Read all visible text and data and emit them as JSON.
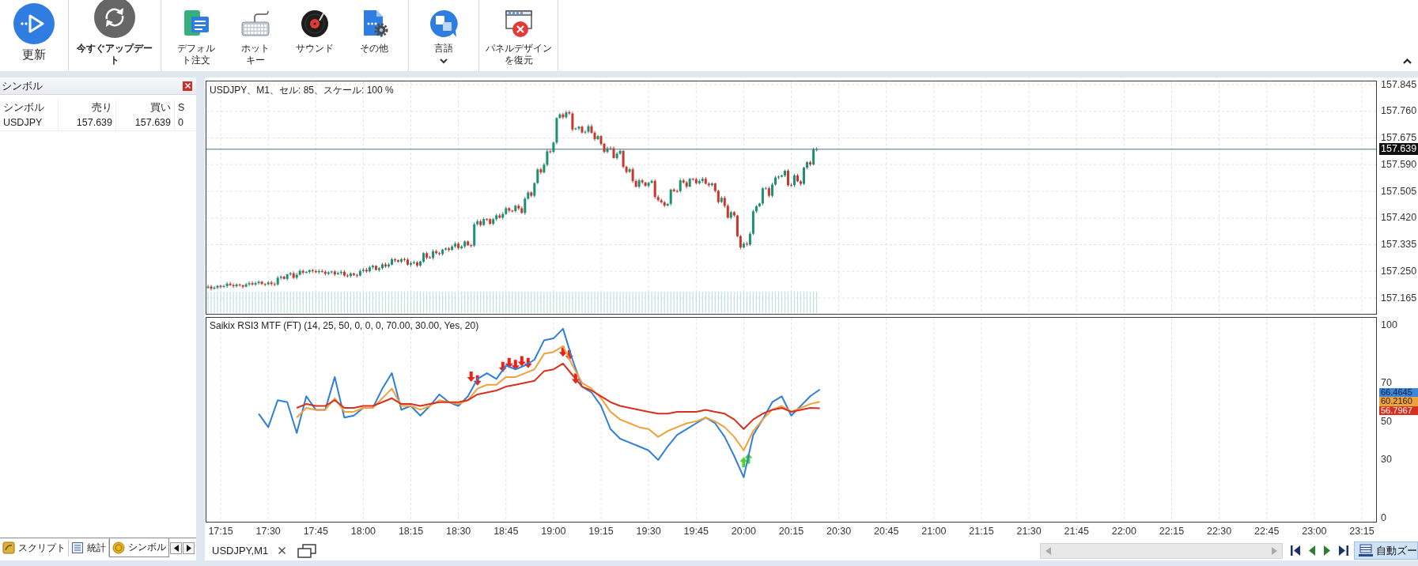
{
  "toolbar": {
    "groups": [
      {
        "buttons": [
          {
            "kind": "refresh",
            "label": "更新",
            "emphasized": false
          }
        ]
      },
      {
        "buttons": [
          {
            "kind": "update",
            "label": "今すぐアップデート",
            "emphasized": true
          }
        ]
      },
      {
        "buttons": [
          {
            "kind": "default_order",
            "label": "デフォルト注文",
            "emphasized": false
          },
          {
            "kind": "hotkey",
            "label": "ホットキー",
            "emphasized": false
          },
          {
            "kind": "sound",
            "label": "サウンド",
            "emphasized": false
          },
          {
            "kind": "other",
            "label": "その他",
            "emphasized": false
          }
        ]
      },
      {
        "buttons": [
          {
            "kind": "language",
            "label": "言語",
            "emphasized": false
          }
        ]
      },
      {
        "buttons": [
          {
            "kind": "restore_panels",
            "label": "パネルデザインを復元",
            "emphasized": false
          }
        ]
      }
    ]
  },
  "symbol_panel": {
    "title": "シンボル",
    "columns": [
      "シンボル",
      "売り",
      "買い",
      "S"
    ],
    "rows": [
      [
        "USDJPY",
        "157.639",
        "157.639",
        "0"
      ]
    ],
    "tabs": [
      {
        "kind": "scripts",
        "label": "スクリプト",
        "selected": false
      },
      {
        "kind": "stats",
        "label": "統計",
        "selected": false
      },
      {
        "kind": "symbols",
        "label": "シンボル",
        "selected": true
      }
    ]
  },
  "chart": {
    "title": "USDJPY、M1、セル: 85、スケール: 100 %",
    "price_axis": [
      "157.845",
      "157.760",
      "157.675",
      "157.590",
      "157.505",
      "157.420",
      "157.335",
      "157.250",
      "157.165"
    ],
    "current_price": "157.639",
    "indicator": {
      "chart_data": {
        "type": "line",
        "title": "Saikix RSI3 MTF (FT) (14, 25, 50, 0, 0, 0, 70.00, 30.00, Yes, 20)",
        "grid": true,
        "categories": [
          null,
          "17:15",
          null,
          null,
          null,
          null,
          "17:30",
          null,
          null,
          null,
          null,
          "17:45",
          null,
          null,
          null,
          null,
          "18:00",
          null,
          null,
          null,
          null,
          "18:15",
          null,
          null,
          null,
          null,
          "18:30",
          null,
          null,
          null,
          null,
          "18:45",
          null,
          null,
          null,
          null,
          "19:00",
          null,
          null,
          null,
          null,
          "19:15",
          null,
          null,
          null,
          null,
          "19:30",
          null,
          null,
          null,
          null,
          "19:45",
          null,
          null,
          null,
          null,
          "20:00",
          null,
          null,
          null,
          null,
          "20:15",
          null,
          null,
          null,
          null,
          "20:30",
          null,
          null,
          null,
          null,
          "20:45",
          null,
          null,
          null,
          null,
          "21:00",
          null,
          null,
          null,
          null,
          "21:15",
          null,
          null,
          null,
          null,
          "21:30",
          null,
          null,
          null,
          null,
          "21:45",
          null,
          null,
          null,
          null,
          "22:00",
          null,
          null,
          null,
          null,
          "22:15",
          null,
          null,
          null,
          null,
          "22:30",
          null,
          null,
          null,
          null,
          "22:45",
          null,
          null,
          null,
          null,
          "23:00",
          null,
          null,
          null,
          null,
          "23:15",
          null
        ],
        "ylim": [
          -2,
          103.7
        ],
        "yticks": [
          0,
          30,
          50,
          70,
          100
        ],
        "series": [
          {
            "color": "#2f7fd8",
            "values": [
              null,
              null,
              null,
              null,
              null,
              54,
              47,
              61,
              60,
              44,
              63,
              56,
              56,
              73,
              52,
              53,
              57,
              57,
              67,
              75,
              56,
              58,
              53,
              58,
              64,
              60,
              58,
              63,
              72,
              75,
              72,
              79,
              77,
              79,
              82,
              92,
              93,
              98,
              82,
              68,
              65,
              58,
              46,
              41,
              39,
              37,
              35,
              30,
              37,
              43,
              46,
              49,
              52,
              49,
              42,
              32,
              21,
              43,
              51,
              60,
              63,
              53,
              58,
              63,
              66.5,
              null,
              null,
              null,
              null,
              null,
              null,
              null,
              null,
              null,
              null,
              null,
              null,
              null,
              null,
              null,
              null,
              null,
              null,
              null,
              null,
              null,
              null,
              null,
              null,
              null,
              null,
              null,
              null,
              null,
              null,
              null,
              null,
              null,
              null,
              null,
              null,
              null,
              null,
              null,
              null,
              null,
              null,
              null,
              null,
              null,
              null,
              null,
              null,
              null,
              null,
              null,
              null,
              null,
              null,
              null,
              null,
              null,
              null
            ]
          },
          {
            "color": "#f0a23a",
            "values": [
              null,
              null,
              null,
              null,
              null,
              null,
              null,
              null,
              null,
              52,
              57,
              56,
              56,
              62,
              55,
              55,
              57,
              57,
              62,
              67,
              58,
              58,
              56,
              58,
              61,
              60,
              59,
              61,
              67,
              69,
              69,
              73,
              73,
              75,
              77,
              85,
              86,
              89,
              79,
              70,
              67,
              62,
              55,
              51,
              49,
              47,
              46,
              42,
              45,
              47,
              49,
              50,
              52,
              50,
              47,
              42,
              35,
              45,
              51,
              56,
              58,
              55,
              57,
              59,
              60.2,
              null,
              null,
              null,
              null,
              null,
              null,
              null,
              null,
              null,
              null,
              null,
              null,
              null,
              null,
              null,
              null,
              null,
              null,
              null,
              null,
              null,
              null,
              null,
              null,
              null,
              null,
              null,
              null,
              null,
              null,
              null,
              null,
              null,
              null,
              null,
              null,
              null,
              null,
              null,
              null,
              null,
              null,
              null,
              null,
              null,
              null,
              null,
              null,
              null,
              null,
              null,
              null,
              null,
              null,
              null,
              null,
              null,
              null
            ]
          },
          {
            "color": "#d8301f",
            "values": [
              null,
              null,
              null,
              null,
              null,
              null,
              null,
              null,
              null,
              57,
              59,
              58,
              58,
              61,
              57,
              57,
              58,
              58,
              60,
              62,
              59,
              59,
              58,
              59,
              60,
              60,
              60,
              61,
              64,
              65,
              66,
              68,
              69,
              70,
              71,
              76,
              77,
              80,
              74,
              68,
              66,
              63,
              60,
              58,
              57,
              56,
              55,
              54,
              54,
              55,
              55,
              55,
              56,
              55,
              54,
              51,
              46,
              51,
              54,
              56,
              57,
              55,
              56,
              57,
              56.8,
              null,
              null,
              null,
              null,
              null,
              null,
              null,
              null,
              null,
              null,
              null,
              null,
              null,
              null,
              null,
              null,
              null,
              null,
              null,
              null,
              null,
              null,
              null,
              null,
              null,
              null,
              null,
              null,
              null,
              null,
              null,
              null,
              null,
              null,
              null,
              null,
              null,
              null,
              null,
              null,
              null,
              null,
              null,
              null,
              null,
              null,
              null,
              null,
              null,
              null,
              null,
              null,
              null,
              null,
              null,
              null,
              null,
              null
            ]
          }
        ]
      },
      "value_tags": [
        {
          "text": "66.4645",
          "color": "#3b86d9"
        },
        {
          "text": "60.2160",
          "color": "#f0a23a"
        },
        {
          "text": "56.7967",
          "color": "#d8301f"
        }
      ]
    },
    "tabs": [
      {
        "label": "USDJPY,M1",
        "selected": true
      }
    ],
    "auto_zoom": {
      "label": "自動ズー",
      "on": true
    }
  }
}
